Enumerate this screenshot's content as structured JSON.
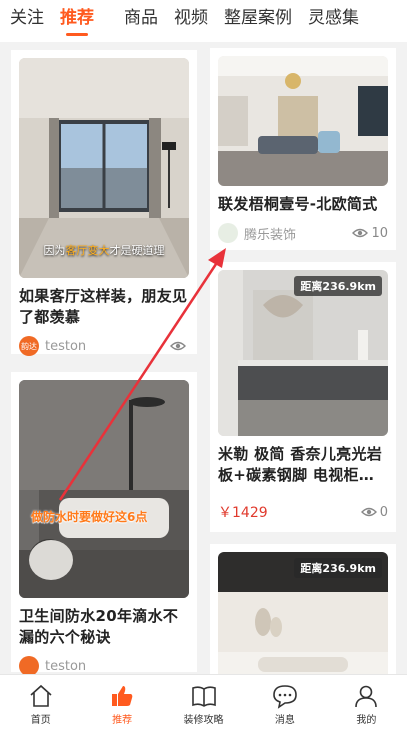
{
  "tabs": [
    {
      "label": "关注",
      "active": false
    },
    {
      "label": "推荐",
      "active": true
    },
    {
      "label": "商品",
      "active": false
    },
    {
      "label": "视频",
      "active": false
    },
    {
      "label": "整屋案例",
      "active": false
    },
    {
      "label": "灵感集",
      "active": false
    }
  ],
  "left_cards": [
    {
      "image_caption_pre": "因为",
      "image_caption_hl": "客厅变大",
      "image_caption_post": "才是硬道理",
      "title": "如果客厅这样装，朋友见了都羡慕",
      "author": "teston",
      "avatar_text": "韵达"
    },
    {
      "image_caption": "做防水时要做好这6点",
      "title": "卫生间防水20年滴水不漏的六个秘诀",
      "author": "teston"
    }
  ],
  "right_cards": [
    {
      "title": "联发梧桐壹号-北欧简式",
      "author": "腾乐装饰",
      "views": "10"
    },
    {
      "distance": "距离236.9km",
      "title": "米勒 极简 香奈儿亮光岩板+碳素钢脚 电视柜…",
      "price": "￥1429",
      "views": "0"
    },
    {
      "distance": "距离236.9km"
    }
  ],
  "bottom_nav": [
    {
      "label": "首页",
      "icon": "home-icon",
      "active": false
    },
    {
      "label": "推荐",
      "icon": "thumb-up-icon",
      "active": true
    },
    {
      "label": "装修攻略",
      "icon": "book-icon",
      "active": false
    },
    {
      "label": "消息",
      "icon": "message-icon",
      "active": false
    },
    {
      "label": "我的",
      "icon": "user-icon",
      "active": false
    }
  ],
  "colors": {
    "accent": "#ff5a1f",
    "price": "#e03a2d",
    "annotation_arrow": "#e8323a"
  }
}
